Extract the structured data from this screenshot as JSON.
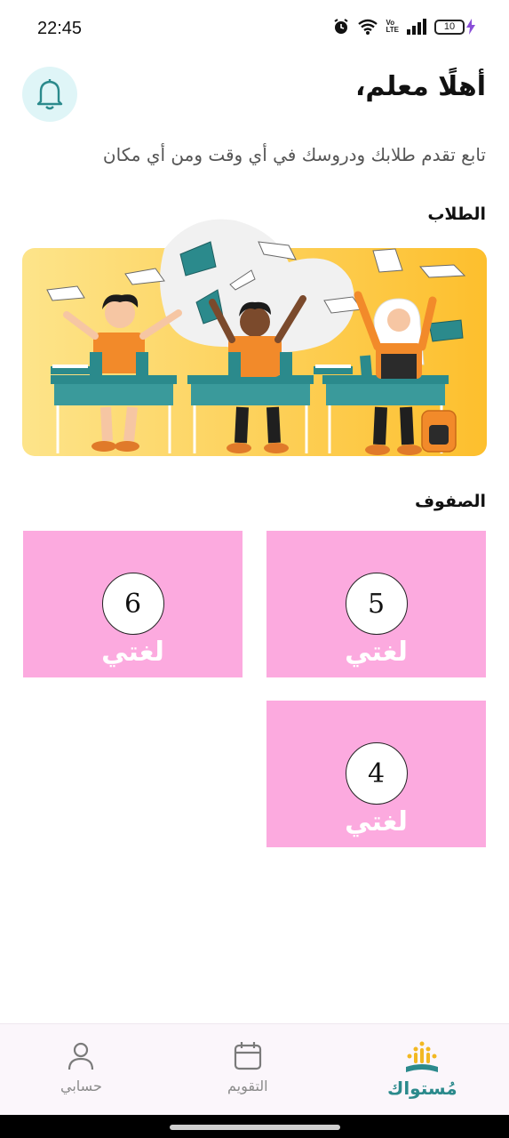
{
  "status_bar": {
    "time": "22:45",
    "battery_level": "10"
  },
  "header": {
    "greeting": "أهلًا معلم،",
    "subtitle": "تابع تقدم طلابك ودروسك في أي وقت ومن أي مكان"
  },
  "students": {
    "title": "الطلاب"
  },
  "classes": {
    "title": "الصفوف",
    "items": [
      {
        "number": "5",
        "label": "لغتي"
      },
      {
        "number": "6",
        "label": "لغتي"
      },
      {
        "number": "4",
        "label": "لغتي"
      }
    ]
  },
  "nav": {
    "brand": "مُستواك",
    "calendar": "التقويم",
    "account": "حسابي"
  },
  "colors": {
    "accent": "#2b8a8c",
    "card": "#fcaadf",
    "bell_bg": "#dff5f7",
    "banner": "#fdc83a"
  }
}
